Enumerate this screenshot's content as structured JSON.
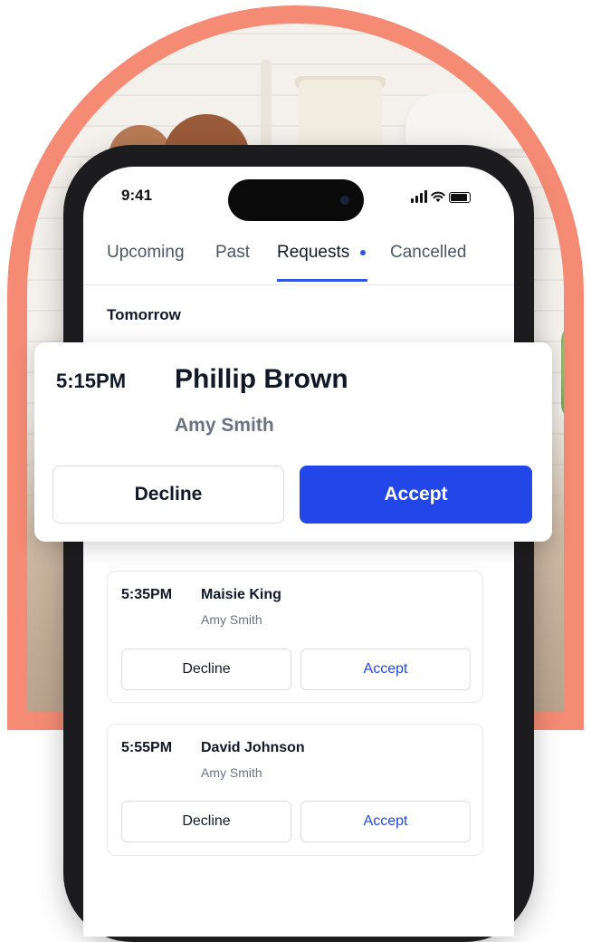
{
  "status_bar": {
    "time": "9:41"
  },
  "tabs": [
    {
      "label": "Upcoming"
    },
    {
      "label": "Past"
    },
    {
      "label": "Requests"
    },
    {
      "label": "Cancelled"
    }
  ],
  "section_label": "Tomorrow",
  "requests": [
    {
      "time": "5:15PM",
      "name": "Phillip Brown",
      "with": "Amy Smith",
      "decline_label": "Decline",
      "accept_label": "Accept"
    },
    {
      "time": "5:35PM",
      "name": "Maisie King",
      "with": "Amy Smith",
      "decline_label": "Decline",
      "accept_label": "Accept"
    },
    {
      "time": "5:55PM",
      "name": "David Johnson",
      "with": "Amy Smith",
      "decline_label": "Decline",
      "accept_label": "Accept"
    }
  ],
  "colors": {
    "accent": "#2346e8",
    "arch": "#f58b74"
  },
  "icons": [
    "signal-icon",
    "wifi-icon",
    "battery-icon"
  ]
}
